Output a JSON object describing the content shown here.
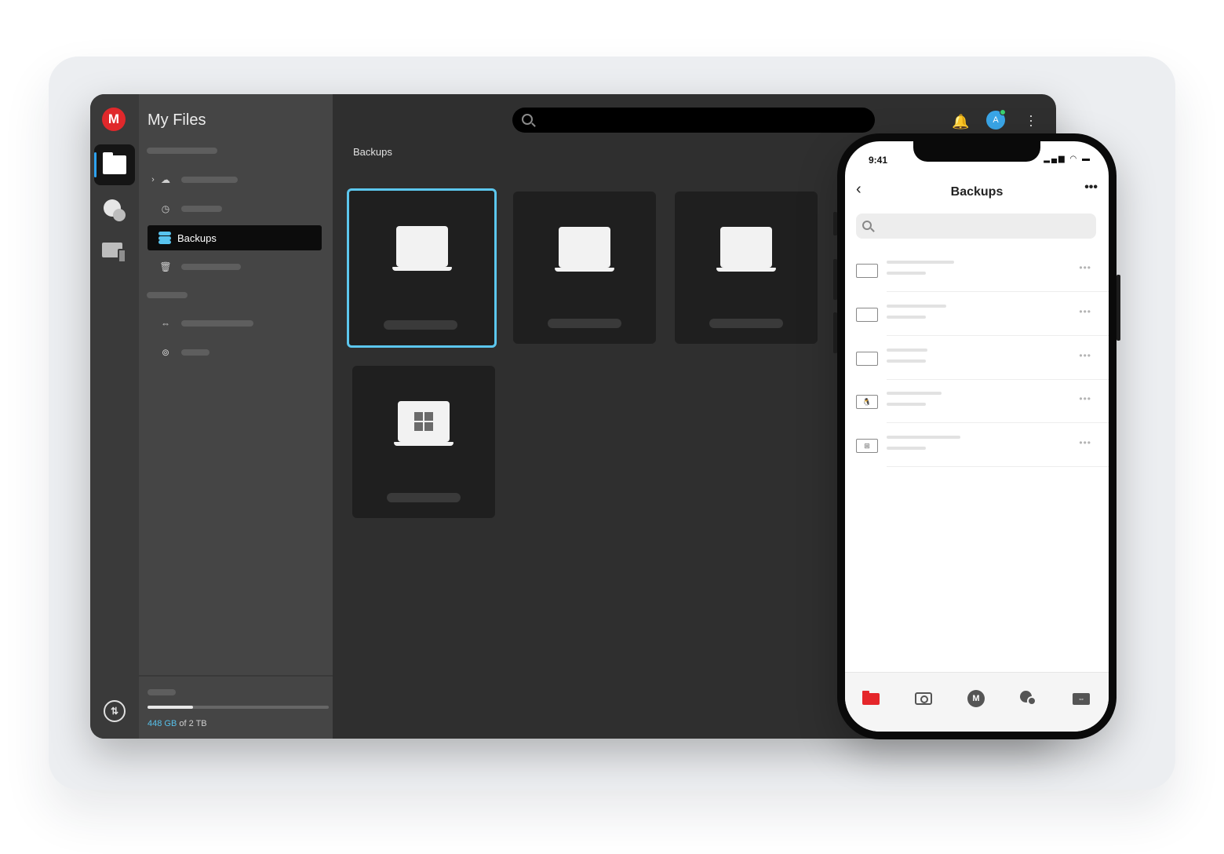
{
  "desktop": {
    "logo_letter": "M",
    "sidebar": {
      "title": "My Files",
      "active_item_label": "Backups",
      "storage_used": "448 GB",
      "storage_total": " of 2 TB",
      "storage_fraction": 0.25
    },
    "header": {
      "avatar_letter": "A"
    },
    "breadcrumb": "Backups",
    "devices": [
      {
        "os": "mac",
        "glyph": "",
        "selected": true
      },
      {
        "os": "laptop",
        "glyph": "",
        "selected": false
      },
      {
        "os": "laptop",
        "glyph": "",
        "selected": false
      },
      {
        "os": "windows",
        "glyph": "",
        "selected": false
      }
    ],
    "accent_color": "#5cc7ee",
    "brand_color": "#e0282b"
  },
  "phone": {
    "time": "9:41",
    "title": "Backups",
    "rows": [
      {
        "icon": "mac-icon",
        "glyph": ""
      },
      {
        "icon": "laptop-icon",
        "glyph": ""
      },
      {
        "icon": "laptop-icon",
        "glyph": ""
      },
      {
        "icon": "linux-icon",
        "glyph": "🐧"
      },
      {
        "icon": "windows-icon",
        "glyph": "⊞"
      }
    ],
    "tab_m": "M",
    "tab_active_color": "#e5262a"
  }
}
